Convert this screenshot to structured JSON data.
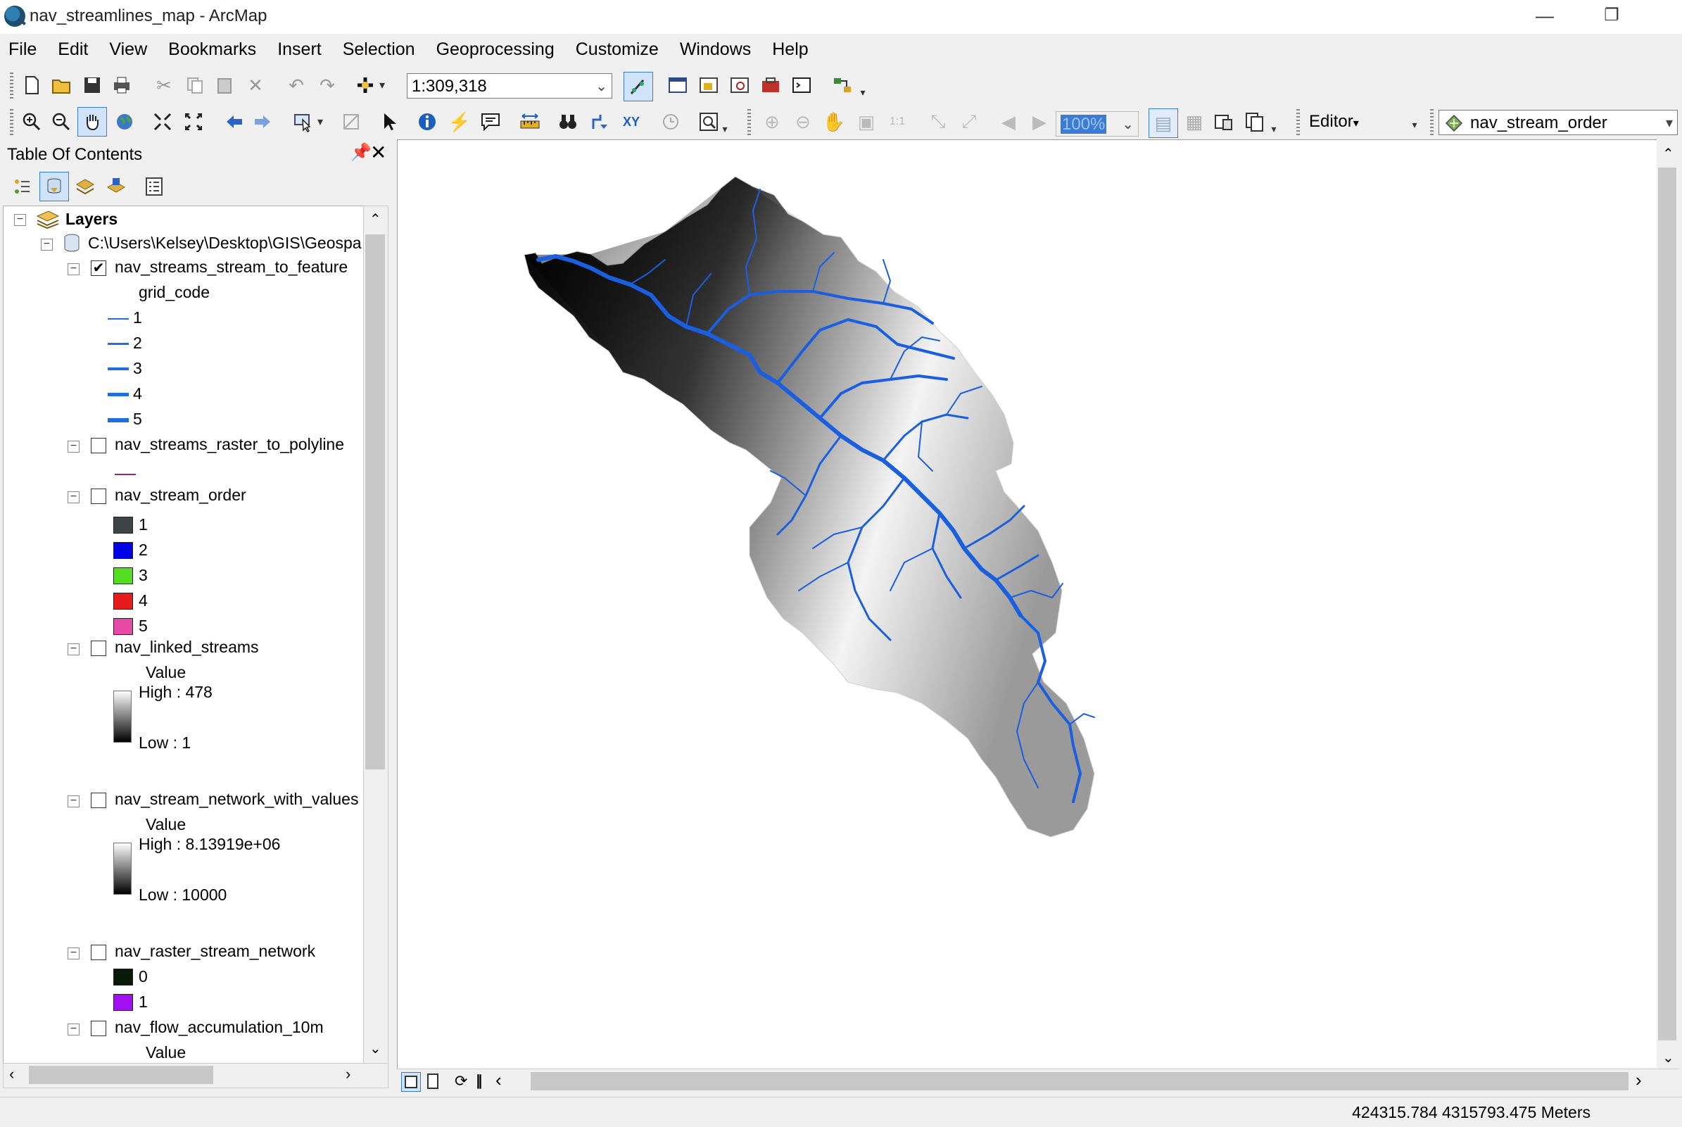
{
  "window": {
    "title": "nav_streamlines_map - ArcMap"
  },
  "menu": [
    "File",
    "Edit",
    "View",
    "Bookmarks",
    "Insert",
    "Selection",
    "Geoprocessing",
    "Customize",
    "Windows",
    "Help"
  ],
  "toolbar": {
    "scale_value": "1:309,318",
    "zoom_value": "100%",
    "editor_label": "Editor",
    "editor_arrow": "▾",
    "layer_select": "nav_stream_order"
  },
  "toc": {
    "title": "Table Of Contents",
    "root": "Layers",
    "datasource": "C:\\Users\\Kelsey\\Desktop\\GIS\\Geospa",
    "layers": [
      {
        "name": "nav_streams_stream_to_feature",
        "checked": "✔",
        "field": "grid_code",
        "classes": [
          "1",
          "2",
          "3",
          "4",
          "5"
        ]
      },
      {
        "name": "nav_streams_raster_to_polyline",
        "checked": ""
      },
      {
        "name": "nav_stream_order",
        "checked": "",
        "classes": [
          "1",
          "2",
          "3",
          "4",
          "5"
        ],
        "colors": [
          "#3c4446",
          "#0000e6",
          "#55dd22",
          "#e61c1c",
          "#e84aa8"
        ]
      },
      {
        "name": "nav_linked_streams",
        "checked": "",
        "field": "Value",
        "high": "High : 478",
        "low": "Low : 1"
      },
      {
        "name": "nav_stream_network_with_values",
        "checked": "",
        "field": "Value",
        "high": "High : 8.13919e+06",
        "low": "Low : 10000"
      },
      {
        "name": "nav_raster_stream_network",
        "checked": "",
        "classes": [
          "0",
          "1"
        ],
        "colors": [
          "#071a0a",
          "#a010f0"
        ]
      },
      {
        "name": "nav_flow_accumulation_10m",
        "checked": "",
        "field": "Value"
      }
    ]
  },
  "map": {
    "stream_color": "#1a5fe0"
  },
  "status": {
    "coordinates": "424315.784  4315793.475 Meters"
  }
}
